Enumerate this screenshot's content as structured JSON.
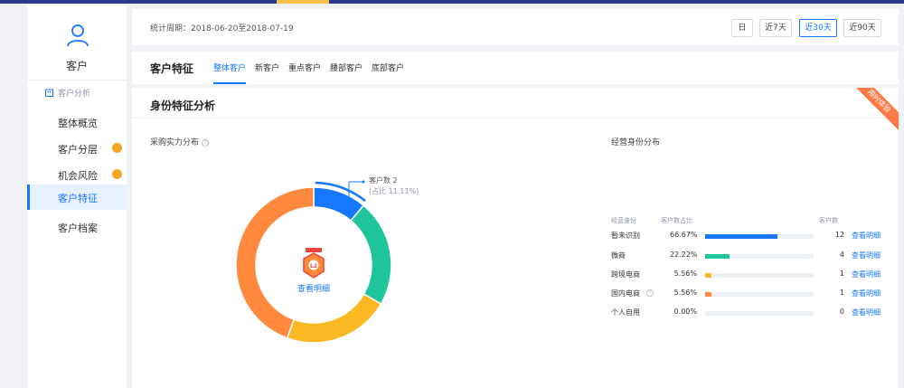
{
  "colors": {
    "primary": "#1677ff",
    "orange": "#ff8a3d",
    "teal": "#1ec59b",
    "yellow": "#fbb924",
    "badge": "#f5a623"
  },
  "sidebar": {
    "title": "客户",
    "section_label": "客户分析",
    "items": [
      {
        "label": "整体概览",
        "dot": false,
        "active": false
      },
      {
        "label": "客户分层",
        "dot": true,
        "active": false
      },
      {
        "label": "机会风险",
        "dot": true,
        "active": false
      },
      {
        "label": "客户特征",
        "dot": false,
        "active": true
      },
      {
        "label": "客户档案",
        "dot": false,
        "active": false
      }
    ]
  },
  "header": {
    "period": "统计周期：2018-06-20至2018-07-19",
    "ranges": [
      {
        "label": "日",
        "active": false
      },
      {
        "label": "近7天",
        "active": false
      },
      {
        "label": "近30天",
        "active": true
      },
      {
        "label": "近90天",
        "active": false
      }
    ]
  },
  "tabs_panel": {
    "title": "客户特征",
    "tabs": [
      {
        "label": "整体客户",
        "active": true
      },
      {
        "label": "新客户",
        "active": false
      },
      {
        "label": "重点客户",
        "active": false
      },
      {
        "label": "腰部客户",
        "active": false
      },
      {
        "label": "底部客户",
        "active": false
      }
    ]
  },
  "main": {
    "title": "身份特征分析",
    "ribbon": "限时体验",
    "left_title": "采购实力分布",
    "callout_count": "客户数 2",
    "callout_ratio": "(占比 11.11%)",
    "center_link": "查看明细",
    "badge_level": "L2",
    "right_title": "经营身份分布",
    "table_headers": {
      "identity": "经营身份",
      "ratio": "客户数占比",
      "count": "客户数"
    },
    "rows": [
      {
        "identity": "暂未识别",
        "ratio": "66.67%",
        "pct": 66.67,
        "count": "12",
        "link": "查看明细",
        "color": "#1677ff",
        "help": false
      },
      {
        "identity": "微商",
        "ratio": "22.22%",
        "pct": 22.22,
        "count": "4",
        "link": "查看明细",
        "color": "#1ec59b",
        "help": false
      },
      {
        "identity": "跨境电商",
        "ratio": "5.56%",
        "pct": 5.56,
        "count": "1",
        "link": "查看明细",
        "color": "#fbb924",
        "help": false
      },
      {
        "identity": "国内电商",
        "ratio": "5.56%",
        "pct": 5.56,
        "count": "1",
        "link": "查看明细",
        "color": "#ff8a3d",
        "help": true
      },
      {
        "identity": "个人自用",
        "ratio": "0.00%",
        "pct": 0,
        "count": "0",
        "link": "查看明细",
        "color": "#1677ff",
        "help": false
      }
    ]
  },
  "donut_chart": {
    "type": "donut",
    "segments": [
      {
        "value": 11.11,
        "color": "#1677ff",
        "highlighted": true
      },
      {
        "value": 22.22,
        "color": "#1ec59b"
      },
      {
        "value": 22.22,
        "color": "#fbb924"
      },
      {
        "value": 44.45,
        "color": "#ff8a3d"
      }
    ]
  }
}
